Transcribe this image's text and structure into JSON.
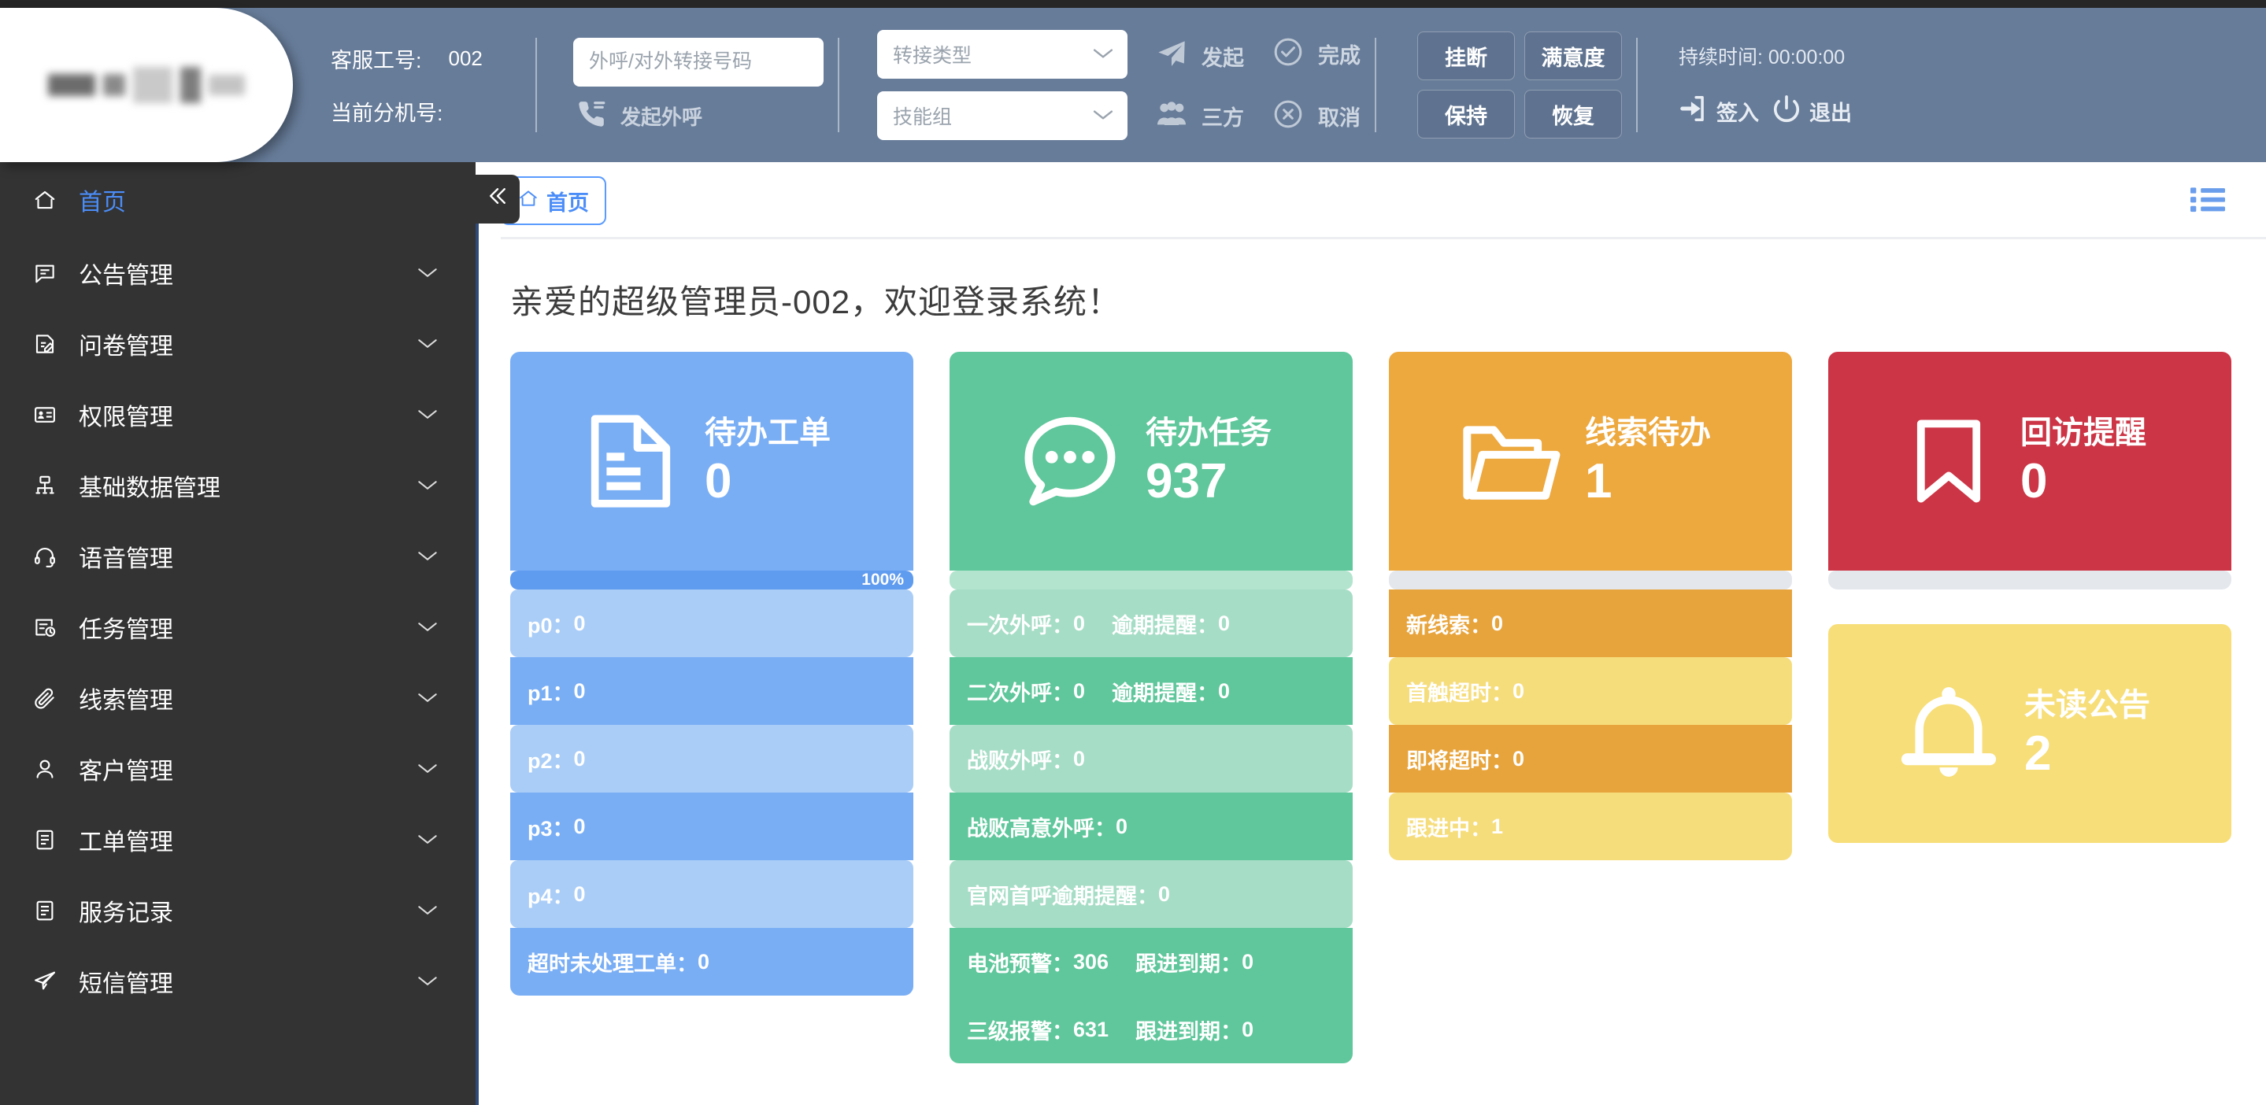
{
  "header": {
    "agent": {
      "id_label": "客服工号:",
      "id_value": "002",
      "ext_label": "当前分机号:",
      "ext_value": ""
    },
    "dial": {
      "number_placeholder": "外呼/对外转接号码",
      "number_value": "",
      "call_out_label": "发起外呼"
    },
    "selects": {
      "transfer_type": "转接类型",
      "skill_group": "技能组"
    },
    "actions": [
      {
        "label": "发起",
        "icon": "send-icon"
      },
      {
        "label": "三方",
        "icon": "users-icon"
      },
      {
        "label": "完成",
        "icon": "check-circle-icon"
      },
      {
        "label": "取消",
        "icon": "x-circle-icon"
      }
    ],
    "buttons": [
      "挂断",
      "满意度",
      "保持",
      "恢复"
    ],
    "status": {
      "duration": "持续时间: 00:00:00",
      "signin_label": "签入",
      "logout_label": "退出"
    }
  },
  "sidebar": {
    "items": [
      {
        "label": "首页",
        "icon": "home-icon",
        "active": true,
        "expandable": false
      },
      {
        "label": "公告管理",
        "icon": "announcement-icon",
        "active": false,
        "expandable": true
      },
      {
        "label": "问卷管理",
        "icon": "questionnaire-icon",
        "active": false,
        "expandable": true
      },
      {
        "label": "权限管理",
        "icon": "id-card-icon",
        "active": false,
        "expandable": true
      },
      {
        "label": "基础数据管理",
        "icon": "database-node-icon",
        "active": false,
        "expandable": true
      },
      {
        "label": "语音管理",
        "icon": "headset-icon",
        "active": false,
        "expandable": true
      },
      {
        "label": "任务管理",
        "icon": "task-clock-icon",
        "active": false,
        "expandable": true
      },
      {
        "label": "线索管理",
        "icon": "paperclip-icon",
        "active": false,
        "expandable": true
      },
      {
        "label": "客户管理",
        "icon": "user-icon",
        "active": false,
        "expandable": true
      },
      {
        "label": "工单管理",
        "icon": "clipboard-icon",
        "active": false,
        "expandable": true
      },
      {
        "label": "服务记录",
        "icon": "clipboard-icon",
        "active": false,
        "expandable": true
      },
      {
        "label": "短信管理",
        "icon": "paper-plane-icon",
        "active": false,
        "expandable": true
      }
    ],
    "collapse_icon": "double-chevron-left-icon"
  },
  "main": {
    "breadcrumb": {
      "label": "首页",
      "icon": "home-icon"
    },
    "list_toggle_icon": "list-icon",
    "welcome": "亲爱的超级管理员-002，欢迎登录系统！",
    "cards": [
      {
        "key": "todo-tickets",
        "title": "待办工单",
        "value": "0",
        "icon": "document-lines-icon",
        "color": "#79aef5",
        "progress_label": "100%",
        "rows": [
          {
            "label": "p0：",
            "value": "0"
          },
          {
            "label": "p1：",
            "value": "0"
          },
          {
            "label": "p2：",
            "value": "0"
          },
          {
            "label": "p3：",
            "value": "0"
          },
          {
            "label": "p4：",
            "value": "0"
          },
          {
            "label": "超时未处理工单：",
            "value": "0"
          }
        ]
      },
      {
        "key": "todo-tasks",
        "title": "待办任务",
        "value": "937",
        "icon": "chat-bubble-icon",
        "color": "#5fc79b",
        "progress_label": "",
        "rows": [
          {
            "label": "一次外呼：",
            "value": "0",
            "label2": "逾期提醒：",
            "value2": "0"
          },
          {
            "label": "二次外呼：",
            "value": "0",
            "label2": "逾期提醒：",
            "value2": "0"
          },
          {
            "label": "战败外呼：",
            "value": "0"
          },
          {
            "label": "战败高意外呼：",
            "value": "0"
          },
          {
            "label": "官网首呼逾期提醒：",
            "value": "0"
          },
          {
            "label": "电池预警：",
            "value": "306",
            "label2": "跟进到期：",
            "value2": "0"
          },
          {
            "label": "三级报警：",
            "value": "631",
            "label2": "跟进到期：",
            "value2": "0"
          }
        ]
      },
      {
        "key": "lead-todo",
        "title": "线索待办",
        "value": "1",
        "icon": "folder-open-icon",
        "color": "#eda83e",
        "progress_label": "",
        "rows": [
          {
            "label": "新线索：",
            "value": "0"
          },
          {
            "label": "首触超时：",
            "value": "0"
          },
          {
            "label": "即将超时：",
            "value": "0"
          },
          {
            "label": "跟进中：",
            "value": "1"
          }
        ]
      },
      {
        "key": "callback-reminder",
        "title": "回访提醒",
        "value": "0",
        "icon": "bookmark-icon",
        "color": "#cc3545",
        "progress_label": "",
        "rows": []
      },
      {
        "key": "unread-announcements",
        "title": "未读公告",
        "value": "2",
        "icon": "bell-icon",
        "color": "#f7de78",
        "progress_label": "",
        "rows": []
      }
    ]
  }
}
